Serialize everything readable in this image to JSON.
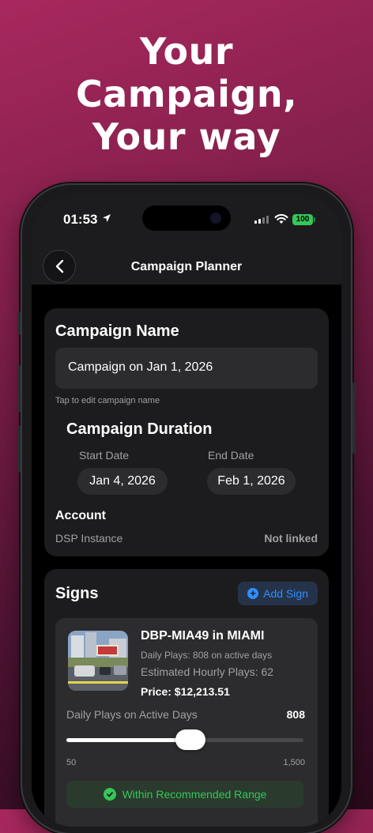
{
  "headline": {
    "line1": "Your",
    "line2": "Campaign,",
    "line3": "Your way"
  },
  "status_bar": {
    "time": "01:53",
    "battery": "100"
  },
  "nav": {
    "title": "Campaign Planner"
  },
  "campaign": {
    "name_title": "Campaign Name",
    "name_value": "Campaign on Jan 1, 2026",
    "name_hint": "Tap to edit campaign name",
    "duration_title": "Campaign Duration",
    "start_label": "Start Date",
    "start_value": "Jan 4, 2026",
    "end_label": "End Date",
    "end_value": "Feb 1, 2026",
    "account_title": "Account",
    "account_label": "DSP Instance",
    "account_value": "Not linked"
  },
  "signs": {
    "title": "Signs",
    "add_label": "Add Sign",
    "items": [
      {
        "name": "DBP-MIA49 in MIAMI",
        "daily_plays": "Daily Plays: 808 on active days",
        "hourly_plays": "Estimated Hourly Plays: 62",
        "price": "Price: $12,213.51",
        "slider_label": "Daily Plays on Active Days",
        "slider_value": "808",
        "slider_min": "50",
        "slider_max": "1,500",
        "slider_fraction": 0.523,
        "range_status": "Within Recommended Range"
      }
    ]
  },
  "colors": {
    "accent": "#2f8fff",
    "success": "#34c759",
    "card": "#1c1c1e"
  }
}
